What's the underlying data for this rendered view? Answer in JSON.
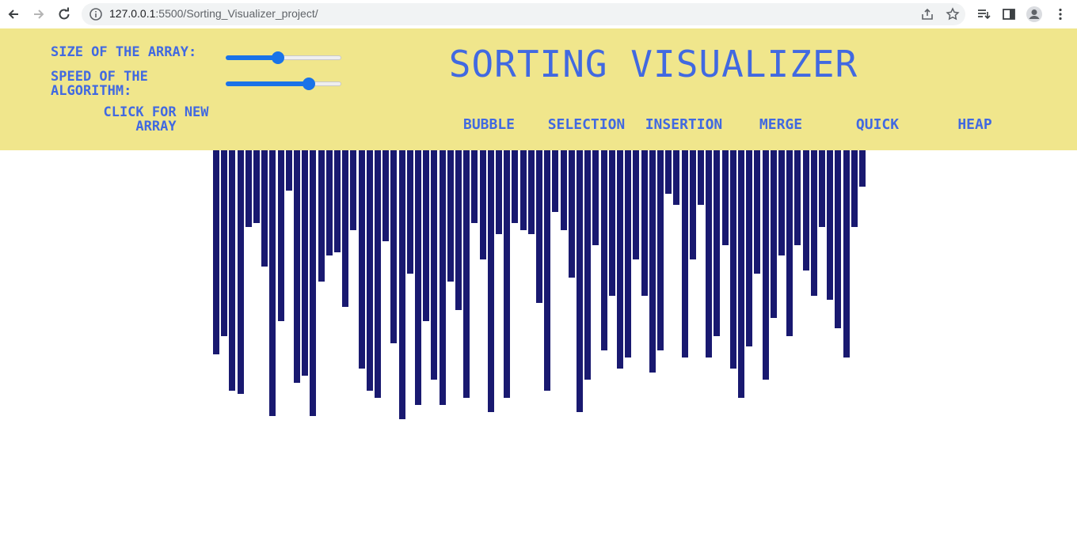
{
  "browser": {
    "url_host": "127.0.0.1",
    "url_path": ":5500/Sorting_Visualizer_project/"
  },
  "controls": {
    "size_label": "SIZE OF THE ARRAY:",
    "size_value": 0.45,
    "speed_label_line1": "SPEED OF THE",
    "speed_label_line2": "ALGORITHM:",
    "speed_value": 0.72,
    "new_array_line1": "CLICK FOR NEW",
    "new_array_line2": "ARRAY"
  },
  "title": "SORTING VISUALIZER",
  "algorithms": [
    "BUBBLE",
    "SELECTION",
    "INSERTION",
    "MERGE",
    "QUICK",
    "HEAP"
  ],
  "colors": {
    "header_bg": "#f0e68c",
    "text": "#4169e1",
    "bar": "#191970",
    "slider": "#1a73e8"
  },
  "bars": [
    258,
    235,
    304,
    308,
    97,
    92,
    147,
    336,
    216,
    51,
    294,
    285,
    336,
    166,
    133,
    129,
    198,
    101,
    276,
    304,
    313,
    115,
    244,
    340,
    156,
    322,
    216,
    290,
    322,
    166,
    202,
    313,
    92,
    138,
    331,
    106,
    313,
    92,
    101,
    106,
    193,
    304,
    78,
    101,
    161,
    331,
    290,
    120,
    253,
    184,
    276,
    262,
    138,
    184,
    281,
    253,
    55,
    69,
    262,
    138,
    69,
    262,
    235,
    120,
    276,
    313,
    248,
    156,
    290,
    212,
    133,
    235,
    120,
    152,
    184,
    97,
    189,
    225,
    262,
    97,
    46
  ]
}
